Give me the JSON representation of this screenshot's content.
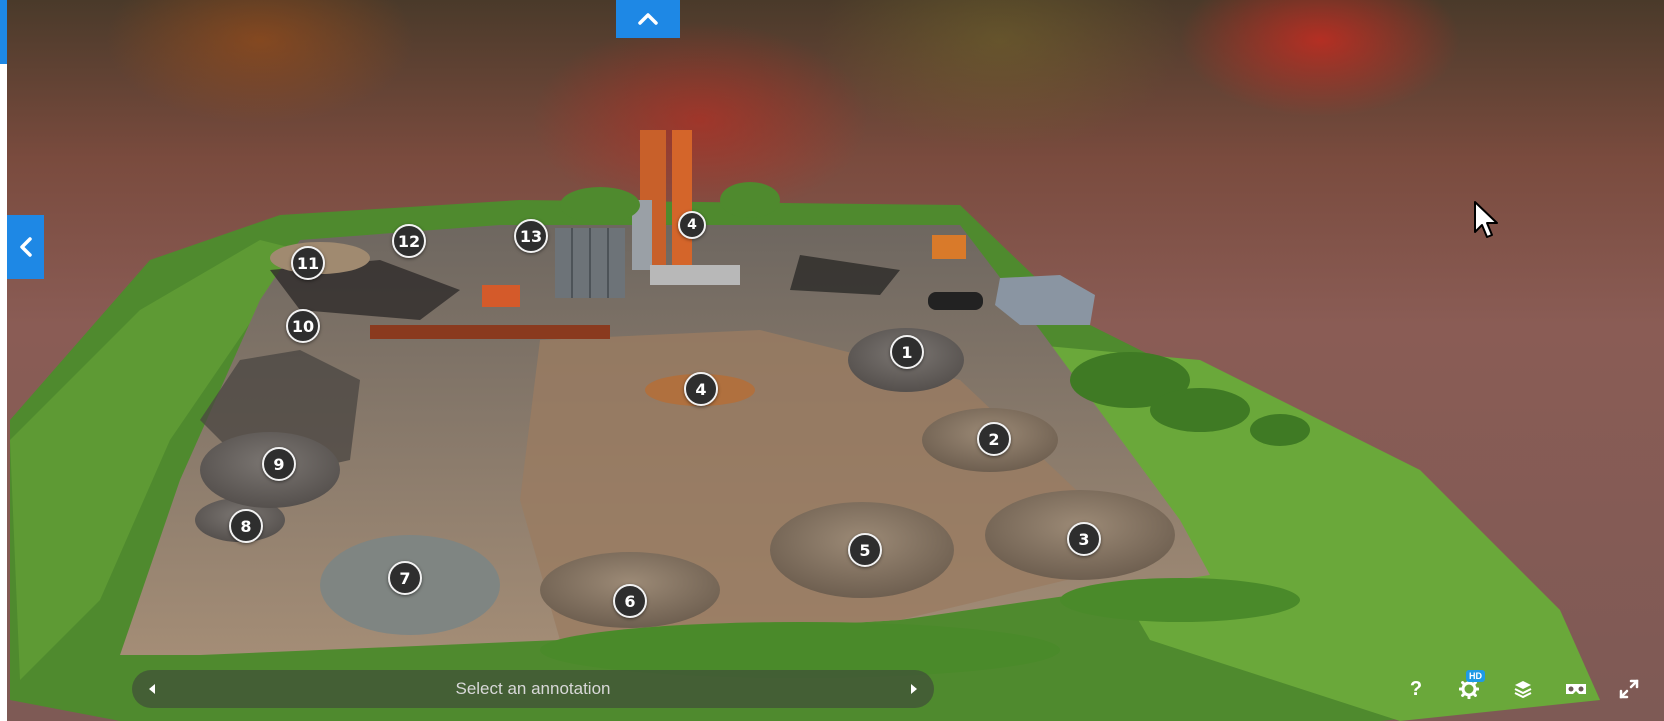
{
  "viewer": {
    "pile_labels": [
      "1",
      "2",
      "3",
      "4",
      "5",
      "6",
      "7",
      "8",
      "9",
      "10",
      "11",
      "12",
      "13",
      "4"
    ]
  },
  "annotation_bar": {
    "placeholder": "Select an annotation",
    "prev_icon": "caret-left-icon",
    "next_icon": "caret-right-icon"
  },
  "toolbar": {
    "help_label": "?",
    "settings_badge": "HD",
    "icons": [
      "help-icon",
      "settings-icon",
      "layers-icon",
      "vr-icon",
      "fullscreen-icon"
    ]
  },
  "nav": {
    "top_toggle_icon": "chevron-up-icon",
    "side_toggle_icon": "chevron-left-icon"
  },
  "colors": {
    "accent": "#1e88e5",
    "badge": "#1e9be5"
  }
}
